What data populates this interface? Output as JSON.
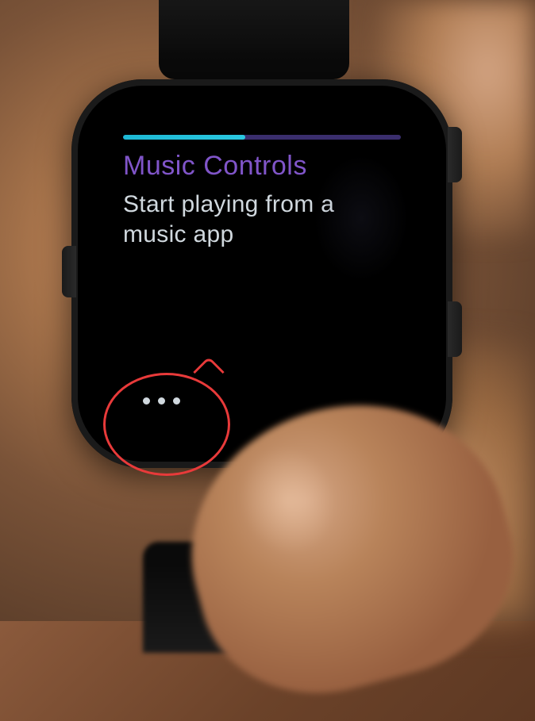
{
  "screen": {
    "title": "Music Controls",
    "body": "Start playing from a music app",
    "progress_percent": 44,
    "dots_count": 3
  },
  "colors": {
    "title": "#8055c9",
    "body_text": "#d0d8de",
    "progress_fill": "#1db8d4",
    "progress_track": "#3a2e6d",
    "annotation": "#e83a3a"
  }
}
